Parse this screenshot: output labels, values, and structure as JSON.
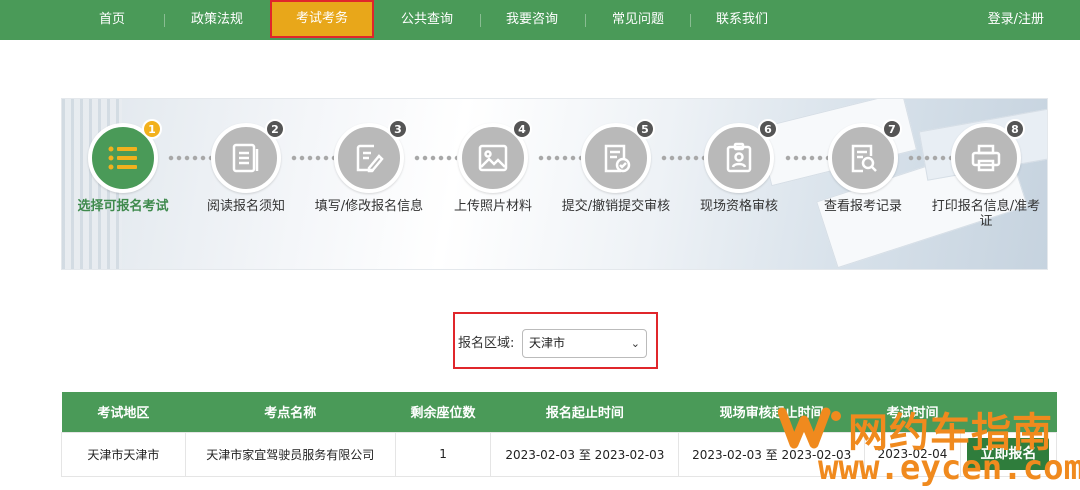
{
  "nav": {
    "items": [
      "首页",
      "政策法规",
      "考试考务",
      "公共查询",
      "我要咨询",
      "常见问题",
      "联系我们"
    ],
    "active_index": 2,
    "login": "登录/注册"
  },
  "steps": [
    {
      "num": "1",
      "label": "选择可报名考试",
      "icon": "list-icon"
    },
    {
      "num": "2",
      "label": "阅读报名须知",
      "icon": "document-icon"
    },
    {
      "num": "3",
      "label": "填写/修改报名信息",
      "icon": "edit-icon"
    },
    {
      "num": "4",
      "label": "上传照片材料",
      "icon": "image-icon"
    },
    {
      "num": "5",
      "label": "提交/撤销提交审核",
      "icon": "check-document-icon"
    },
    {
      "num": "6",
      "label": "现场资格审核",
      "icon": "id-card-icon"
    },
    {
      "num": "7",
      "label": "查看报考记录",
      "icon": "search-document-icon"
    },
    {
      "num": "8",
      "label": "打印报名信息/准考证",
      "icon": "printer-icon"
    }
  ],
  "region": {
    "label": "报名区域:",
    "selected": "天津市"
  },
  "table": {
    "headers": [
      "考试地区",
      "考点名称",
      "剩余座位数",
      "报名起止时间",
      "现场审核起止时间",
      "考试时间",
      ""
    ],
    "rows": [
      [
        "天津市天津市",
        "天津市家宜驾驶员服务有限公司",
        "1",
        "2023-02-03 至 2023-02-03",
        "2023-02-03 至 2023-02-03",
        "2023-02-04",
        "立即报名"
      ]
    ]
  },
  "watermark": {
    "cn": "网约车指南",
    "en": "www.eycen.com"
  },
  "colors": {
    "nav_green": "#4a9a58",
    "active_orange": "#e8a71a",
    "highlight_red": "#e0262b",
    "watermark_orange": "#f08a1e"
  }
}
